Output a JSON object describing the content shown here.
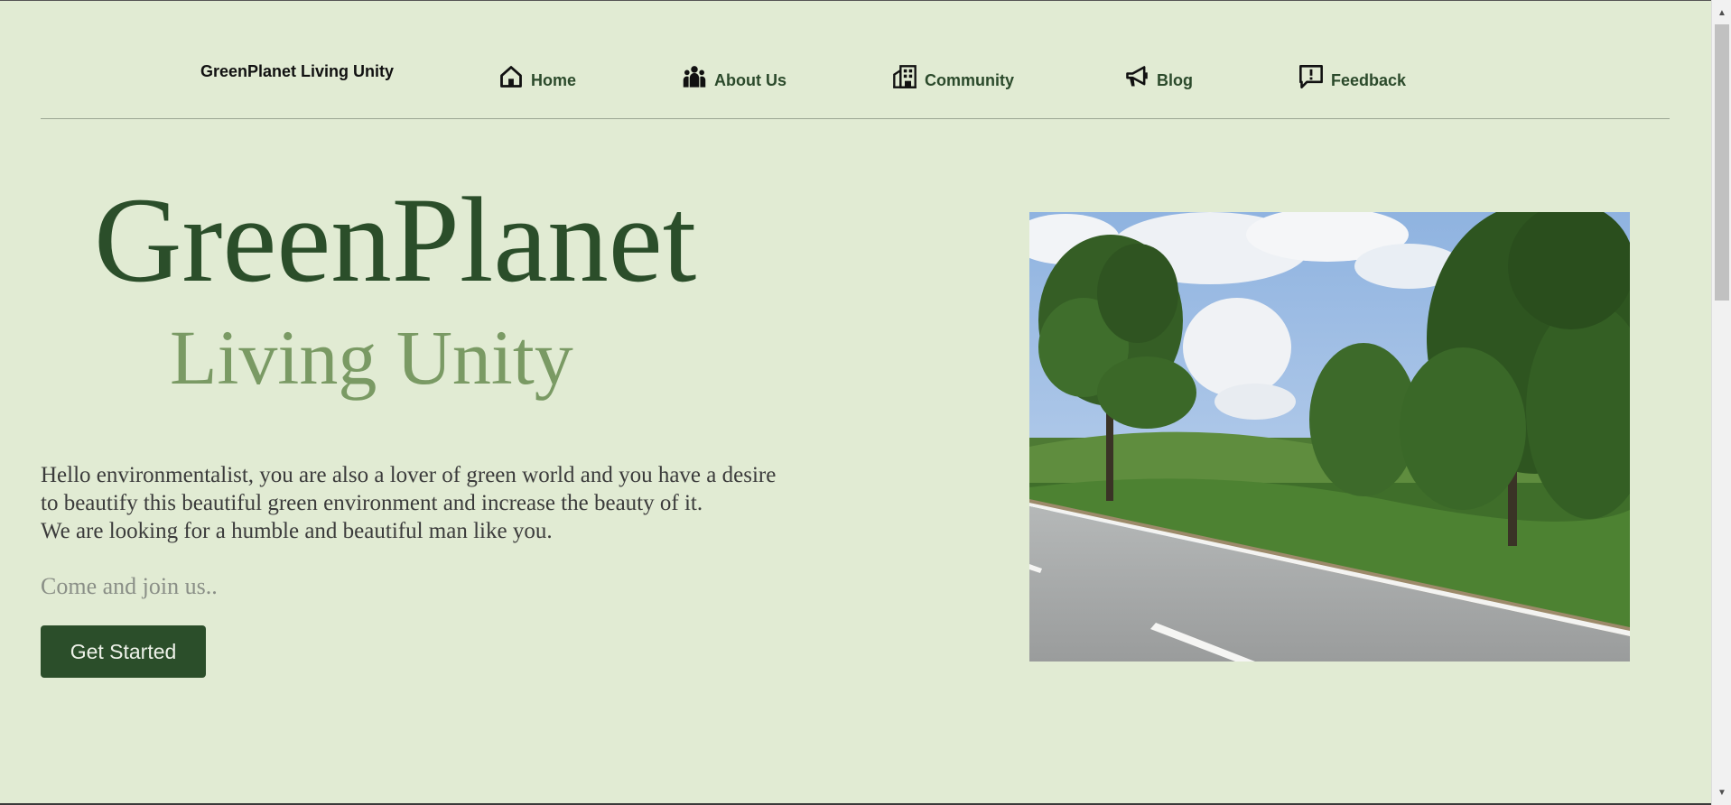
{
  "nav": {
    "brand": "GreenPlanet Living Unity",
    "items": [
      {
        "label": "Home",
        "icon": "home-icon"
      },
      {
        "label": "About Us",
        "icon": "people-icon"
      },
      {
        "label": "Community",
        "icon": "buildings-icon"
      },
      {
        "label": "Blog",
        "icon": "megaphone-icon"
      },
      {
        "label": "Feedback",
        "icon": "feedback-icon"
      }
    ]
  },
  "hero": {
    "title": "GreenPlanet",
    "subtitle": "Living Unity",
    "intro_lines": [
      "Hello environmentalist, you are also a lover of green world and you have a desire",
      "to beautify this beautiful green environment and increase the beauty of it.",
      "We are looking for a humble and beautiful man like you."
    ],
    "join_text": "Come and join us..",
    "cta_label": "Get Started"
  },
  "colors": {
    "background": "#e1ebd3",
    "primary": "#2b4e2a",
    "subtitle": "#7a9a64",
    "muted": "#8a8f87"
  }
}
